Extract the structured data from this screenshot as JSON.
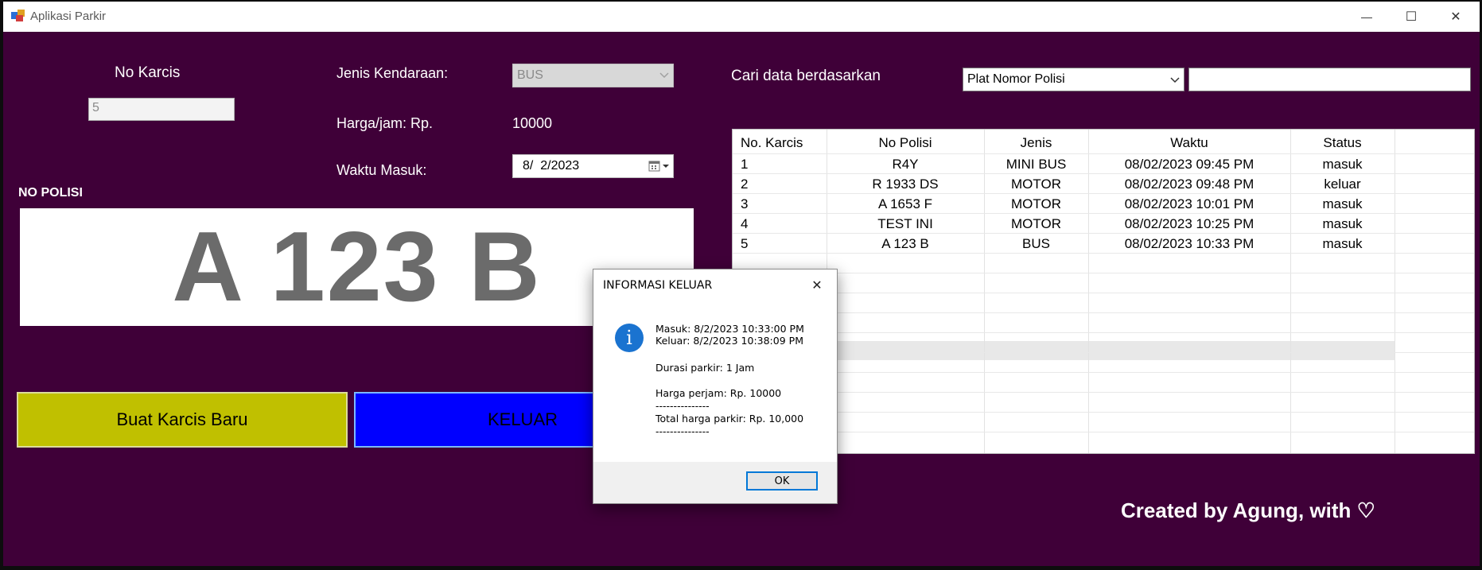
{
  "window": {
    "title": "Aplikasi Parkir",
    "minimize_glyph": "—",
    "maximize_glyph": "☐",
    "close_glyph": "✕"
  },
  "form": {
    "no_karcis_label": "No Karcis",
    "no_karcis_value": "5",
    "jenis_label": "Jenis Kendaraan:",
    "jenis_value": "BUS",
    "harga_label": "Harga/jam: Rp.",
    "harga_value": "10000",
    "waktu_label": "Waktu Masuk:",
    "waktu_value": "8/  2/2023",
    "no_polisi_label": "NO POLISI",
    "plate_value": "A 123 B"
  },
  "buttons": {
    "buat_karcis": "Buat Karcis Baru",
    "keluar": "KELUAR"
  },
  "search": {
    "label": "Cari data berdasarkan",
    "field_option": "Plat Nomor Polisi",
    "query": ""
  },
  "table": {
    "columns": [
      "No. Karcis",
      "No Polisi",
      "Jenis",
      "Waktu",
      "Status"
    ],
    "rows": [
      [
        "1",
        "R4Y",
        "MINI BUS",
        "08/02/2023 09:45 PM",
        "masuk"
      ],
      [
        "2",
        "R 1933 DS",
        "MOTOR",
        "08/02/2023 09:48 PM",
        "keluar"
      ],
      [
        "3",
        "A 1653 F",
        "MOTOR",
        "08/02/2023 10:01 PM",
        "masuk"
      ],
      [
        "4",
        "TEST INI",
        "MOTOR",
        "08/02/2023 10:25 PM",
        "masuk"
      ],
      [
        "5",
        "A 123 B",
        "BUS",
        "08/02/2023 10:33 PM",
        "masuk"
      ]
    ],
    "selected_row_index": 4
  },
  "dialog": {
    "title": "INFORMASI KELUAR",
    "close_glyph": "✕",
    "icon_glyph": "i",
    "lines": [
      "Masuk: 8/2/2023 10:33:00 PM",
      "Keluar: 8/2/2023 10:38:09 PM",
      "Durasi parkir: 1 Jam",
      "Harga perjam: Rp. 10000",
      "---------------",
      "Total harga parkir: Rp. 10,000",
      "---------------"
    ],
    "ok_label": "OK"
  },
  "footer": {
    "credit": "Created by Agung, with",
    "heart_glyph": "♡"
  },
  "colors": {
    "background": "#3f0038",
    "buat_button": "#c0c000",
    "keluar_button": "#0000ff",
    "plate_text": "#6b6b6b",
    "selected_row": "#e8e8e8",
    "dialog_icon": "#1a73d0"
  }
}
